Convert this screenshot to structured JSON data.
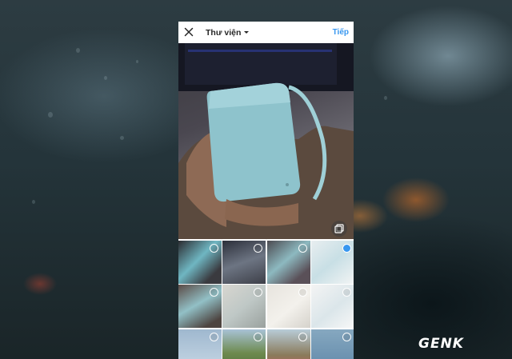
{
  "header": {
    "title": "Thư viện",
    "next_label": "Tiếp",
    "close_icon": "close-icon",
    "dropdown_icon": "caret-down-icon"
  },
  "preview": {
    "multi_select_icon": "multi-select-icon"
  },
  "gallery": {
    "items": [
      {
        "selected": false
      },
      {
        "selected": false
      },
      {
        "selected": false
      },
      {
        "selected": true
      },
      {
        "selected": false
      },
      {
        "selected": false
      },
      {
        "selected": false
      },
      {
        "selected": false
      },
      {
        "selected": false
      },
      {
        "selected": false
      },
      {
        "selected": false
      },
      {
        "selected": false
      }
    ]
  },
  "watermark": {
    "text": "GENK"
  },
  "colors": {
    "accent": "#3897f0",
    "text": "#262626"
  }
}
